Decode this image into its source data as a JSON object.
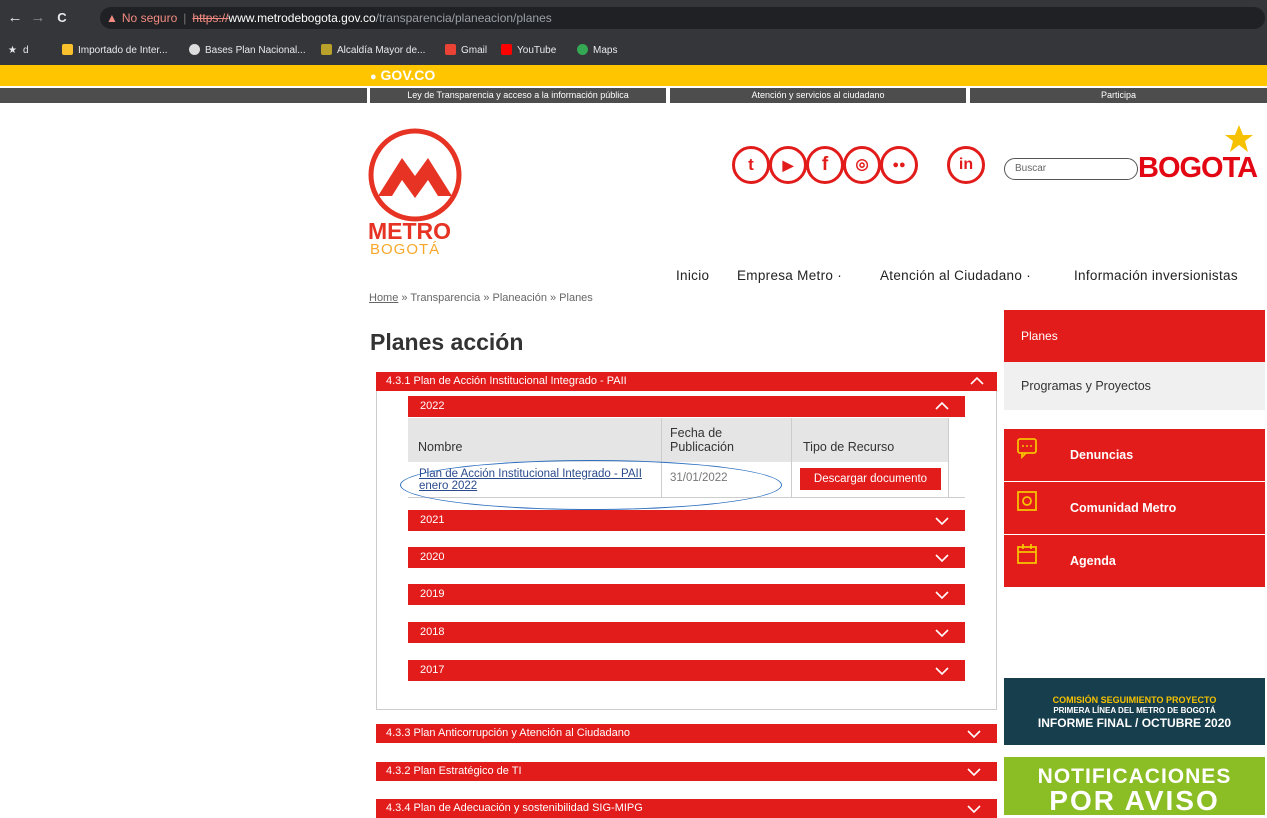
{
  "browser": {
    "warning_label": "No seguro",
    "url_scheme": "https://",
    "url_host": "www.metrodebogota.gov.co",
    "url_path": "/transparencia/planeacion/planes",
    "bookmarks": [
      {
        "label": "d",
        "icon": "star-icon"
      },
      {
        "label": "Importado de Inter...",
        "icon": "folder-icon"
      },
      {
        "label": "Bases Plan Nacional...",
        "icon": "globe-icon"
      },
      {
        "label": "Alcaldía Mayor de...",
        "icon": "shield-icon"
      },
      {
        "label": "Gmail",
        "icon": "gmail-icon"
      },
      {
        "label": "YouTube",
        "icon": "youtube-icon"
      },
      {
        "label": "Maps",
        "icon": "maps-icon"
      }
    ]
  },
  "gov_bar": {
    "logo": "GOV.CO"
  },
  "top_links": [
    "Ley de Transparencia y acceso a la información pública",
    "Atención y servicios al ciudadano",
    "Participa"
  ],
  "brand": {
    "line1": "METRO",
    "line2": "BOGOTÁ",
    "city_logo": "BOGOTA"
  },
  "social": [
    "twitter-icon",
    "youtube-icon",
    "facebook-icon",
    "instagram-icon",
    "flickr-icon",
    "linkedin-icon"
  ],
  "search": {
    "placeholder": "Buscar"
  },
  "nav": [
    "Inicio",
    "Empresa Metro ·",
    "Atención al Ciudadano ·",
    "Información inversionistas"
  ],
  "breadcrumb": {
    "home": "Home",
    "rest": " » Transparencia » Planeación » Planes"
  },
  "page_title": "Planes acción",
  "accordion": {
    "main": "4.3.1 Plan de Acción Institucional Integrado - PAII",
    "years": [
      "2022",
      "2021",
      "2020",
      "2019",
      "2018",
      "2017"
    ],
    "table": {
      "col_name": "Nombre",
      "col_date_1": "Fecha de",
      "col_date_2": "Publicación",
      "col_type": "Tipo de Recurso",
      "row_link_1": "Plan de Acción Institucional Integrado - PAII",
      "row_link_2": "enero 2022",
      "row_date": "31/01/2022",
      "row_button": "Descargar documento"
    },
    "others": [
      "4.3.3 Plan Anticorrupción y Atención al Ciudadano",
      "4.3.2 Plan Estratégico de TI",
      "4.3.4 Plan de Adecuación y sostenibilidad SIG-MIPG"
    ]
  },
  "sidebar": {
    "planes": "Planes",
    "programas": "Programas y Proyectos",
    "denuncias": "Denuncias",
    "comunidad": "Comunidad Metro",
    "agenda": "Agenda"
  },
  "banners": {
    "commission_l1": "COMISIÓN SEGUIMIENTO PROYECTO",
    "commission_l2": "PRIMERA LÍNEA DEL METRO DE BOGOTÁ",
    "commission_l3": "INFORME FINAL  / OCTUBRE 2020",
    "notif_l1": "NOTIFICACIONES",
    "notif_l2": "POR AVISO"
  },
  "colors": {
    "accent": "#e21b1b",
    "gov_yellow": "#ffc600",
    "dark_bar": "#4d4d4d"
  }
}
